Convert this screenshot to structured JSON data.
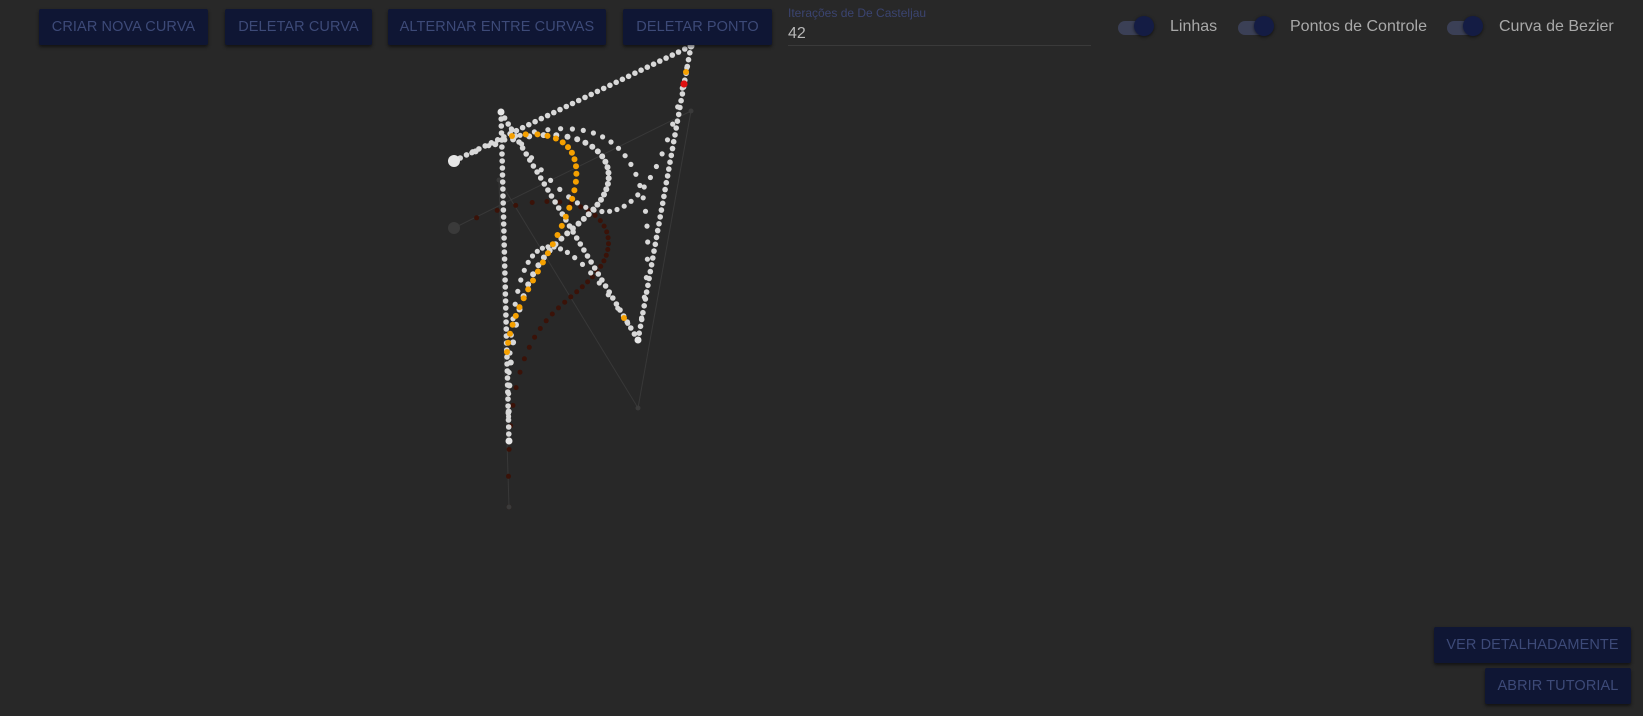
{
  "toolbar": {
    "create_curve": "CRIAR NOVA CURVA",
    "delete_curve": "DELETAR CURVA",
    "toggle_curves": "ALTERNAR ENTRE CURVAS",
    "delete_point": "DELETAR PONTO"
  },
  "iterations": {
    "label": "Iterações de De Casteljau",
    "value": "42"
  },
  "toggles": {
    "lines": {
      "label": "Linhas",
      "on": true
    },
    "control_points": {
      "label": "Pontos de Controle",
      "on": true
    },
    "bezier_curve": {
      "label": "Curva de Bezier",
      "on": true
    }
  },
  "bottom_buttons": {
    "details": "VER DETALHADAMENTE",
    "tutorial": "ABRIR TUTORIAL"
  },
  "colors": {
    "background": "#282828",
    "button_bg": "#0f1634",
    "button_text": "#3d4a78",
    "active_curve": "#d8d8d8",
    "inactive_curve": "#3a1208",
    "highlight": "#f5a000",
    "selected_point": "#e01010"
  }
}
